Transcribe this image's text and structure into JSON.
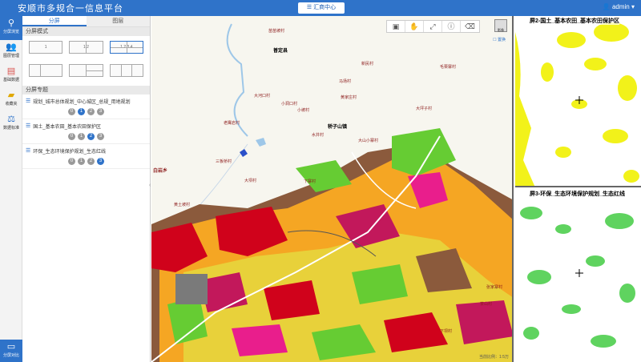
{
  "header": {
    "title": "安顺市多规合一信息平台",
    "center_label": "汇商中心",
    "user": "admin"
  },
  "nav": {
    "items": [
      {
        "label": "分屏浏览",
        "icon": "map-share-icon"
      },
      {
        "label": "图层管理",
        "icon": "users-icon"
      },
      {
        "label": "基础数据",
        "icon": "layers-icon"
      },
      {
        "label": "收藏夹",
        "icon": "folder-icon"
      },
      {
        "label": "数据标准",
        "icon": "scale-icon"
      }
    ],
    "bottom": "分屏对比"
  },
  "panel": {
    "tabs": [
      "分屏",
      "图层"
    ],
    "mode_section": "分屏模式",
    "modes": [
      {
        "cells": "1"
      },
      {
        "cells": "1 2"
      },
      {
        "cells": "1 2 3 4"
      },
      {
        "cells": ""
      },
      {
        "cells": ""
      },
      {
        "cells": ""
      }
    ],
    "topic_section": "分屏专题",
    "topics": [
      {
        "label": "规划_城市总体规划_中心城区_总规_用地规划",
        "pages": [
          "0",
          "1",
          "2",
          "3"
        ],
        "active": 1
      },
      {
        "label": "国土_基本农田_基本农田保护区",
        "pages": [
          "0",
          "1",
          "2",
          "3"
        ],
        "active": 2
      },
      {
        "label": "环保_生态环境保护规划_生态红线",
        "pages": [
          "0",
          "1",
          "2",
          "3"
        ],
        "active": 3
      }
    ]
  },
  "map": {
    "tools": [
      "briefcase",
      "hand",
      "fullscreen",
      "info",
      "eraser"
    ],
    "basemap_label": "影像",
    "swap_label": "置换",
    "county_label": "普定县",
    "town_label": "轿子山镇",
    "labels": [
      "大河口村",
      "小洞口村",
      "马场村",
      "苗苗坡村",
      "新民村",
      "小坡村",
      "水井村",
      "大山小寨村",
      "白岩乡",
      "大坝村",
      "下寨村",
      "三板桥村",
      "黄土坡村",
      "毛栗寨村",
      "大坪子村",
      "黄家庄村",
      "张家寨村",
      "茶山村",
      "下坝村",
      "老鹰岩村"
    ],
    "scale_text": "当前比例：1:5万"
  },
  "screens": [
    {
      "title": "屏2-国土_基本农田_基本农田保护区",
      "color": "#f2f21a"
    },
    {
      "title": "屏3-环保_生态环境保护规划_生态红线",
      "color": "#5fd35f"
    }
  ]
}
